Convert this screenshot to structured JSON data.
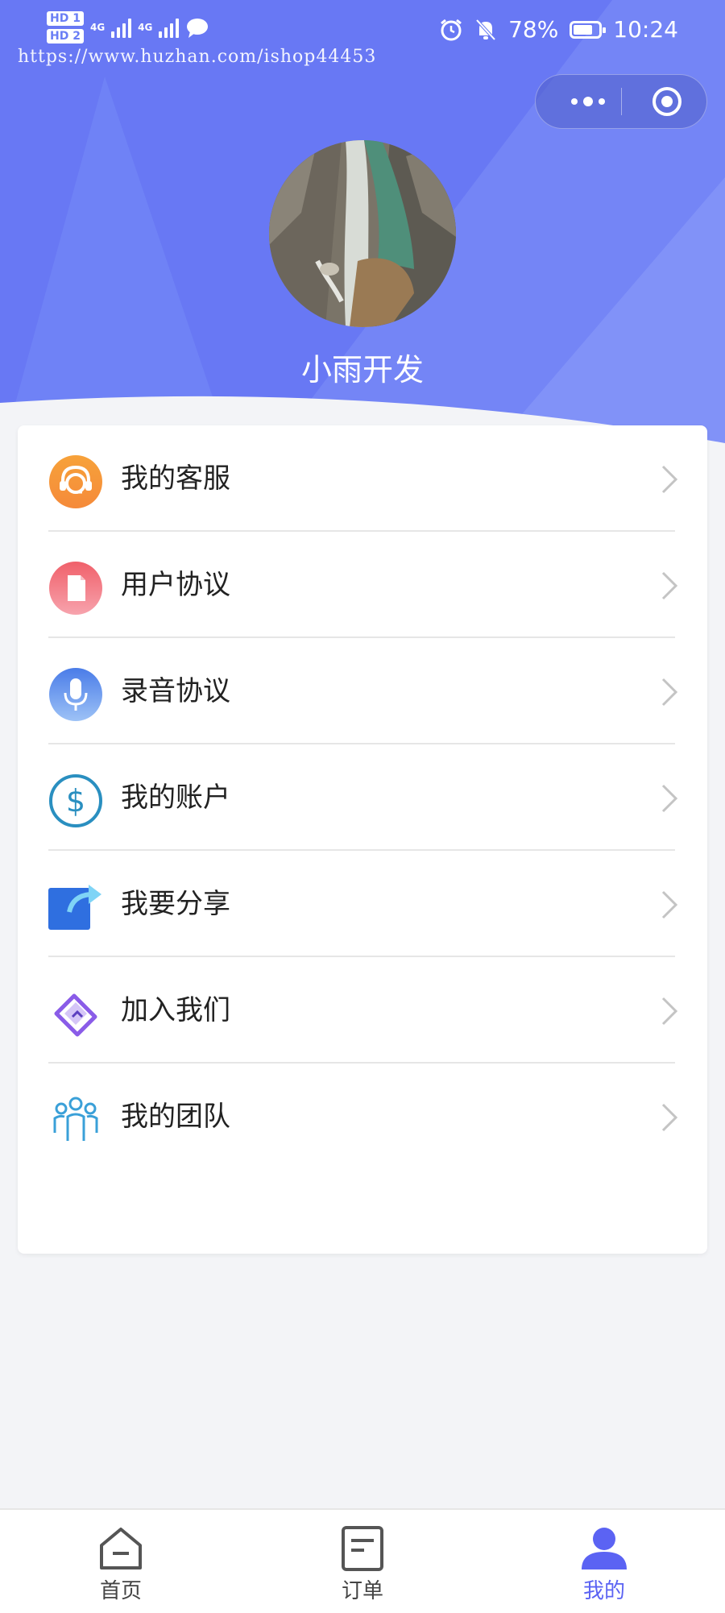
{
  "status_bar": {
    "hd1": "HD",
    "sim1": "1",
    "hd2": "HD",
    "sim2": "2",
    "network1": "4G",
    "network2": "4G",
    "battery_percent": "78%",
    "battery_level": 0.78,
    "time": "10:24",
    "icons": [
      "alarm-icon",
      "mute-bell-icon",
      "chat-bubble-icon"
    ]
  },
  "watermark": "https://www.huzhan.com/ishop44453",
  "capsule": {
    "more_icon": "more-dots-icon",
    "close_icon": "target-close-icon"
  },
  "profile": {
    "username": "小雨开发",
    "avatar": "waterfall-photo"
  },
  "menu": {
    "items": [
      {
        "label": "我的客服",
        "icon": "headset-icon"
      },
      {
        "label": "用户协议",
        "icon": "document-icon"
      },
      {
        "label": "录音协议",
        "icon": "microphone-icon"
      },
      {
        "label": "我的账户",
        "icon": "dollar-icon"
      },
      {
        "label": "我要分享",
        "icon": "share-icon"
      },
      {
        "label": "加入我们",
        "icon": "handshake-icon"
      },
      {
        "label": "我的团队",
        "icon": "team-icon"
      }
    ]
  },
  "tabbar": {
    "tabs": [
      {
        "label": "首页",
        "icon": "home-icon"
      },
      {
        "label": "订单",
        "icon": "order-icon"
      },
      {
        "label": "我的",
        "icon": "user-icon"
      }
    ],
    "active_index": 2
  },
  "colors": {
    "header": "#6a7ef5",
    "accent": "#5b63f3",
    "background": "#f3f4f7"
  }
}
